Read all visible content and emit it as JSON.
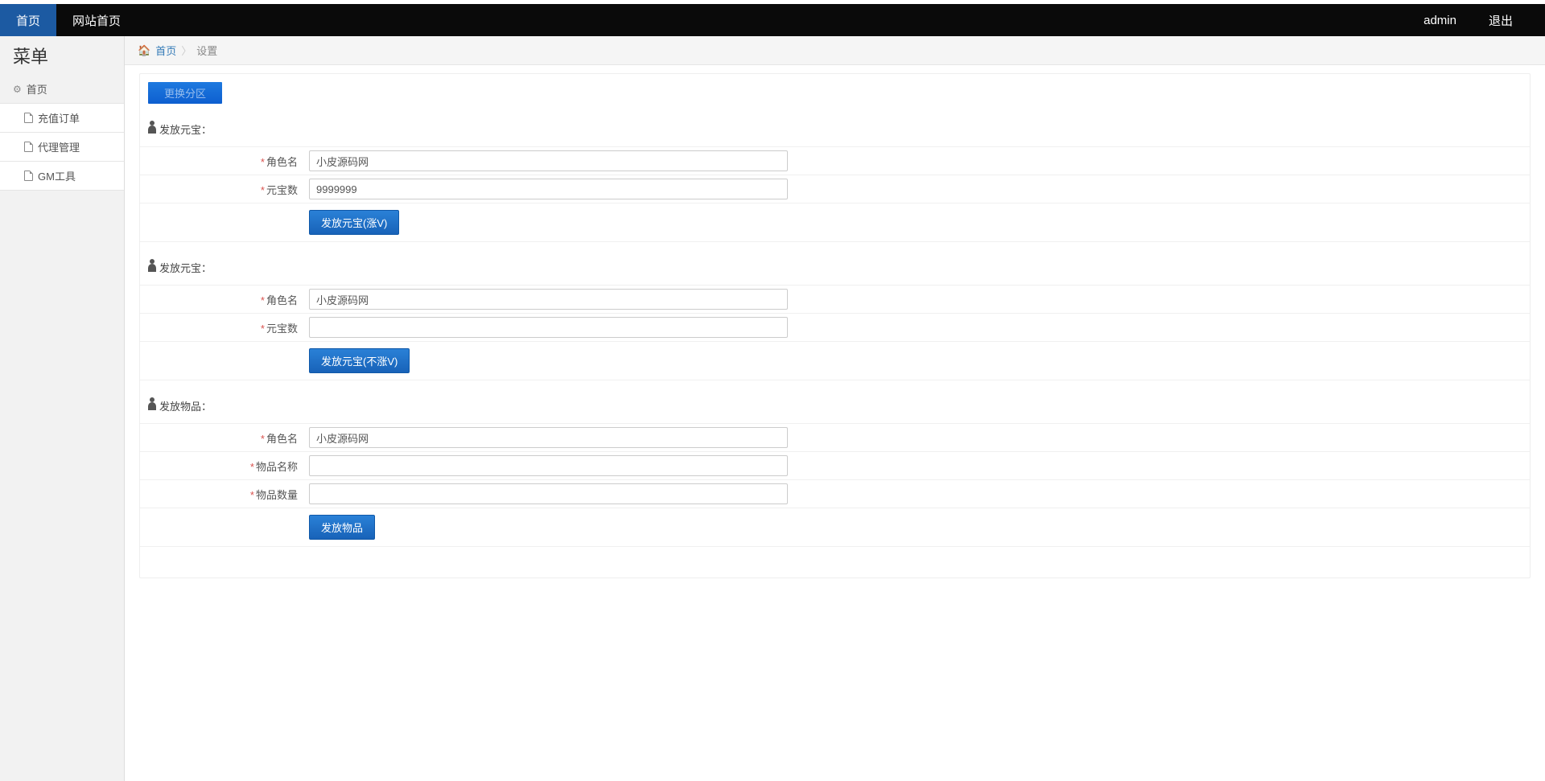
{
  "topbar": {
    "home": "首页",
    "site_home": "网站首页",
    "user": "admin",
    "logout": "退出"
  },
  "sidebar": {
    "title": "菜单",
    "root": "首页",
    "items": [
      {
        "label": "充值订单"
      },
      {
        "label": "代理管理"
      },
      {
        "label": "GM工具"
      }
    ]
  },
  "breadcrumb": {
    "home": "首页",
    "current": "设置"
  },
  "region_button": "更换分区",
  "section1": {
    "title": "发放元宝：",
    "role_label": "角色名",
    "role_value": "小皮源码网",
    "amount_label": "元宝数",
    "amount_value": "9999999",
    "submit": "发放元宝(涨V)"
  },
  "section2": {
    "title": "发放元宝：",
    "role_label": "角色名",
    "role_value": "小皮源码网",
    "amount_label": "元宝数",
    "amount_value": "",
    "submit": "发放元宝(不涨V)"
  },
  "section3": {
    "title": "发放物品：",
    "role_label": "角色名",
    "role_value": "小皮源码网",
    "item_name_label": "物品名称",
    "item_name_value": "",
    "item_qty_label": "物品数量",
    "item_qty_value": "",
    "submit": "发放物品"
  }
}
